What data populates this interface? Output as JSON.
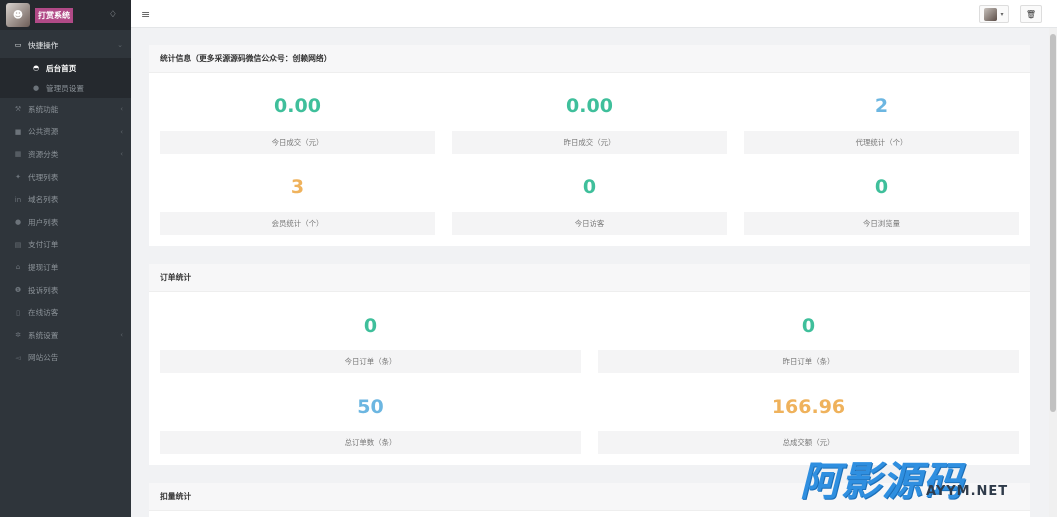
{
  "brand": {
    "name": "打赏系统",
    "icon": "droplet-icon"
  },
  "sidebar": {
    "groups": [
      {
        "label": "快捷操作",
        "icon": "folder-open-icon",
        "children": [
          {
            "label": "后台首页",
            "icon": "dashboard-icon",
            "active": true
          },
          {
            "label": "管理员设置",
            "icon": "user-icon",
            "active": false
          }
        ]
      }
    ],
    "items": [
      {
        "label": "系统功能",
        "icon": "wrench-icon",
        "has_children": true
      },
      {
        "label": "公共资源",
        "icon": "video-icon",
        "has_children": true
      },
      {
        "label": "资源分类",
        "icon": "grid-icon",
        "has_children": true
      },
      {
        "label": "代理列表",
        "icon": "users-icon",
        "has_children": false
      },
      {
        "label": "域名列表",
        "icon": "linkedin-icon",
        "has_children": false
      },
      {
        "label": "用户列表",
        "icon": "user-icon",
        "has_children": false
      },
      {
        "label": "支付订单",
        "icon": "list-icon",
        "has_children": false
      },
      {
        "label": "提现订单",
        "icon": "bank-icon",
        "has_children": false
      },
      {
        "label": "投诉列表",
        "icon": "info-icon",
        "has_children": false
      },
      {
        "label": "在线访客",
        "icon": "file-icon",
        "has_children": false
      },
      {
        "label": "系统设置",
        "icon": "gear-icon",
        "has_children": true
      },
      {
        "label": "网站公告",
        "icon": "bullhorn-icon",
        "has_children": false
      }
    ]
  },
  "topbar": {
    "menu_icon": "hamburger-icon",
    "trash_icon": "trash-icon"
  },
  "stats_panel": {
    "title": "统计信息（更多采源源码微信公众号：创赖网络）",
    "items": [
      {
        "value": "0.00",
        "label": "今日成交（元）",
        "color": "#3fbf9b"
      },
      {
        "value": "0.00",
        "label": "昨日成交（元）",
        "color": "#3fbf9b"
      },
      {
        "value": "2",
        "label": "代理统计（个）",
        "color": "#6cb6e1"
      },
      {
        "value": "3",
        "label": "会员统计（个）",
        "color": "#efb25c"
      },
      {
        "value": "0",
        "label": "今日访客",
        "color": "#3fbf9b"
      },
      {
        "value": "0",
        "label": "今日浏览量",
        "color": "#3fbf9b"
      }
    ]
  },
  "orders_panel": {
    "title": "订单统计",
    "items": [
      {
        "value": "0",
        "label": "今日订单（条）",
        "color": "#3fbf9b"
      },
      {
        "value": "0",
        "label": "昨日订单（条）",
        "color": "#3fbf9b"
      },
      {
        "value": "50",
        "label": "总订单数（条）",
        "color": "#6cb6e1"
      },
      {
        "value": "166.96",
        "label": "总成交额（元）",
        "color": "#efb25c"
      }
    ]
  },
  "deduct_panel": {
    "title": "扣量统计"
  },
  "watermark": {
    "big": "阿影源码",
    "small": "AYYM.NET"
  }
}
